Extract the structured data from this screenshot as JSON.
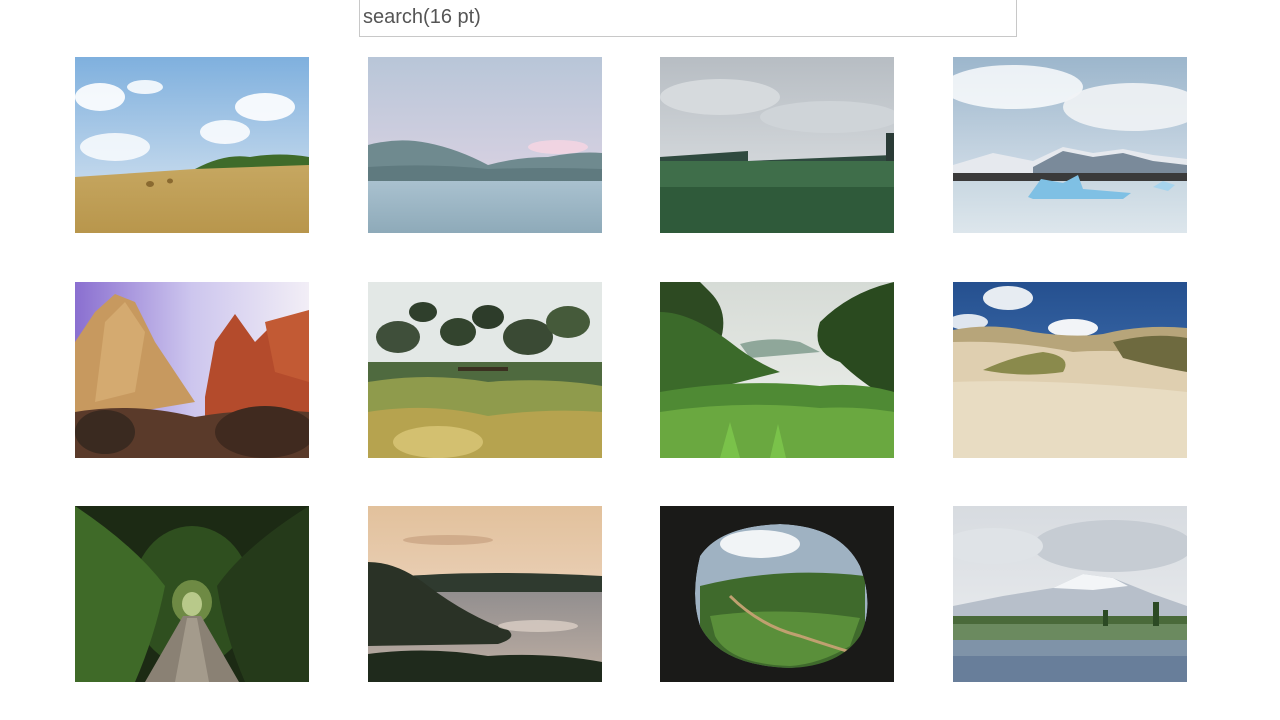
{
  "search": {
    "placeholder": "search(16 pt)"
  },
  "gallery": {
    "photos": [
      {
        "subject": "hay-field"
      },
      {
        "subject": "mountain-lake"
      },
      {
        "subject": "green-meadow"
      },
      {
        "subject": "glacier-lagoon"
      },
      {
        "subject": "red-rock-canyon"
      },
      {
        "subject": "garden-pines"
      },
      {
        "subject": "green-valley"
      },
      {
        "subject": "sand-dunes"
      },
      {
        "subject": "forest-path"
      },
      {
        "subject": "coastal-sunset"
      },
      {
        "subject": "cave-view"
      },
      {
        "subject": "lupine-field"
      }
    ]
  }
}
